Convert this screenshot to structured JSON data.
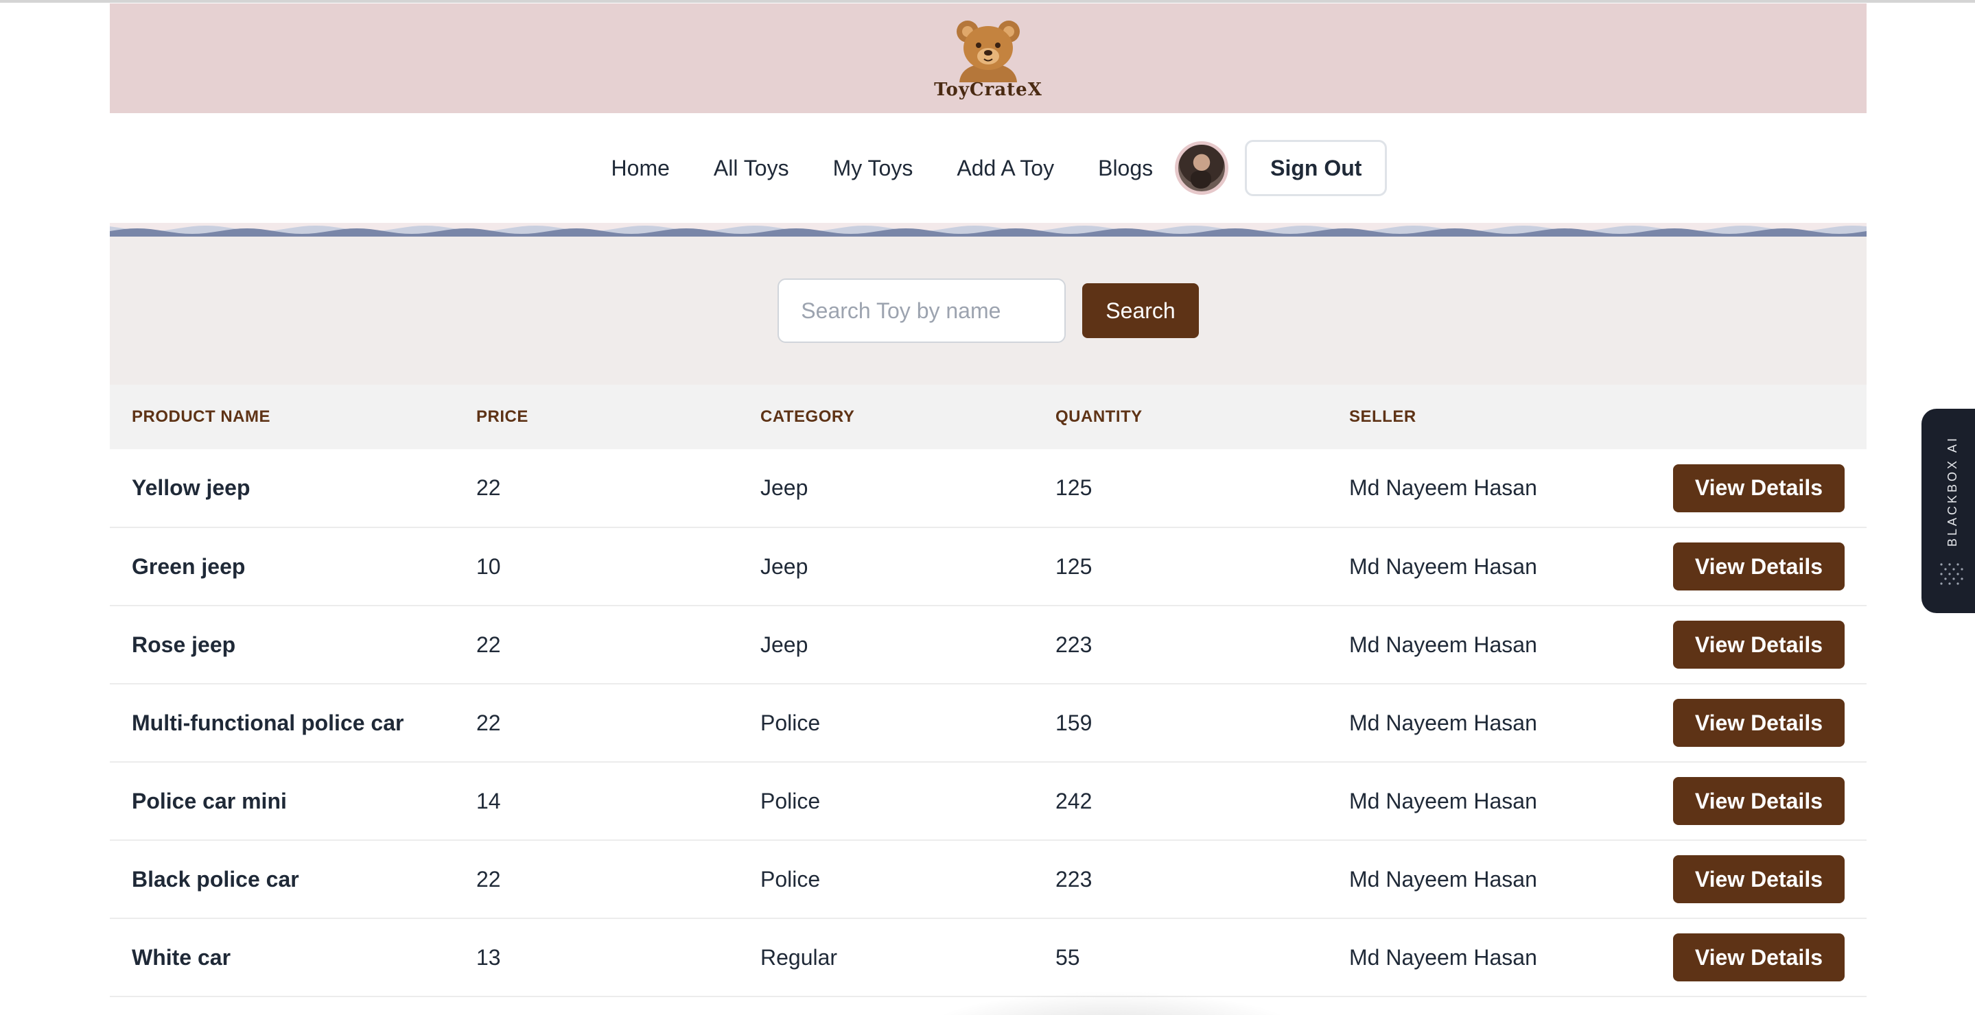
{
  "brand": {
    "name": "ToyCrateX"
  },
  "nav": {
    "links": [
      "Home",
      "All Toys",
      "My Toys",
      "Add A Toy",
      "Blogs"
    ],
    "sign_out": "Sign Out"
  },
  "search": {
    "placeholder": "Search Toy by name",
    "value": "",
    "button": "Search"
  },
  "table": {
    "headers": [
      "PRODUCT NAME",
      "PRICE",
      "CATEGORY",
      "QUANTITY",
      "SELLER"
    ],
    "action_label": "View Details",
    "rows": [
      {
        "name": "Yellow jeep",
        "price": "22",
        "category": "Jeep",
        "quantity": "125",
        "seller": "Md Nayeem Hasan"
      },
      {
        "name": "Green jeep",
        "price": "10",
        "category": "Jeep",
        "quantity": "125",
        "seller": "Md Nayeem Hasan"
      },
      {
        "name": "Rose jeep",
        "price": "22",
        "category": "Jeep",
        "quantity": "223",
        "seller": "Md Nayeem Hasan"
      },
      {
        "name": "Multi-functional police car",
        "price": "22",
        "category": "Police",
        "quantity": "159",
        "seller": "Md Nayeem Hasan"
      },
      {
        "name": "Police car mini",
        "price": "14",
        "category": "Police",
        "quantity": "242",
        "seller": "Md Nayeem Hasan"
      },
      {
        "name": "Black police car",
        "price": "22",
        "category": "Police",
        "quantity": "223",
        "seller": "Md Nayeem Hasan"
      },
      {
        "name": "White car",
        "price": "13",
        "category": "Regular",
        "quantity": "55",
        "seller": "Md Nayeem Hasan"
      }
    ]
  },
  "side_tab": {
    "label": "BLACKBOX AI"
  },
  "colors": {
    "accent": "#5e3316",
    "header_bg": "#e6d1d2",
    "search_bg": "#f0eceb",
    "wave": "#7986a8"
  }
}
